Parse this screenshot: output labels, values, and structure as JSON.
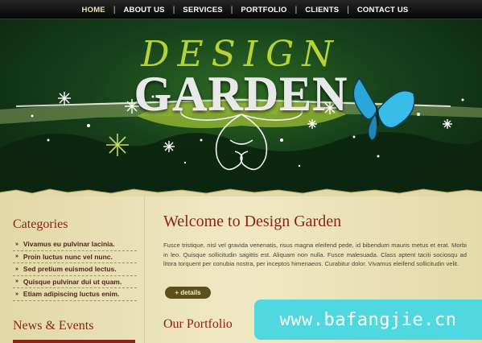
{
  "nav": {
    "items": [
      "HOME",
      "ABOUT US",
      "SERVICES",
      "PORTFOLIO",
      "CLIENTS",
      "CONTACT US"
    ],
    "separator": "|"
  },
  "header": {
    "title_top": "DESIGN",
    "title_bottom": "GARDEN"
  },
  "sidebar": {
    "categories_title": "Categories",
    "bullet": "»",
    "categories": [
      "Vivamus eu pulvinar lacinia.",
      "Proin luctus nunc vel nunc.",
      "Sed pretium euismod lectus.",
      "Quisque pulvinar dui ut quam.",
      "Etiam adipiscing luctus enim."
    ],
    "news_title": "News & Events"
  },
  "main": {
    "welcome_title": "Welcome to Design Garden",
    "paragraph": "Fusce tristique, nisl vel gravida venenatis, risus magna eleifend pede, id bibendum mauris metus et erat. Morbi in leo. Quisque sollicitudin sagittis est. Aliquam non nulla. Fusce malesuada. Class aptent taciti sociosqu ad litora torquent per conubia nostra, per inceptos himenaeos. Curabitur dolor. Vivamus eleifend sollicitudin velit.",
    "details_label": "+ details",
    "portfolio_title": "Our Portfolio"
  },
  "watermark": {
    "text": "www.bafangjie.cn"
  },
  "colors": {
    "nav_bg": "#0a0a0a",
    "header_green": "#16401a",
    "accent_red": "#8a2418",
    "title_green": "#b5d434",
    "watermark_bg": "#4fd8df"
  }
}
